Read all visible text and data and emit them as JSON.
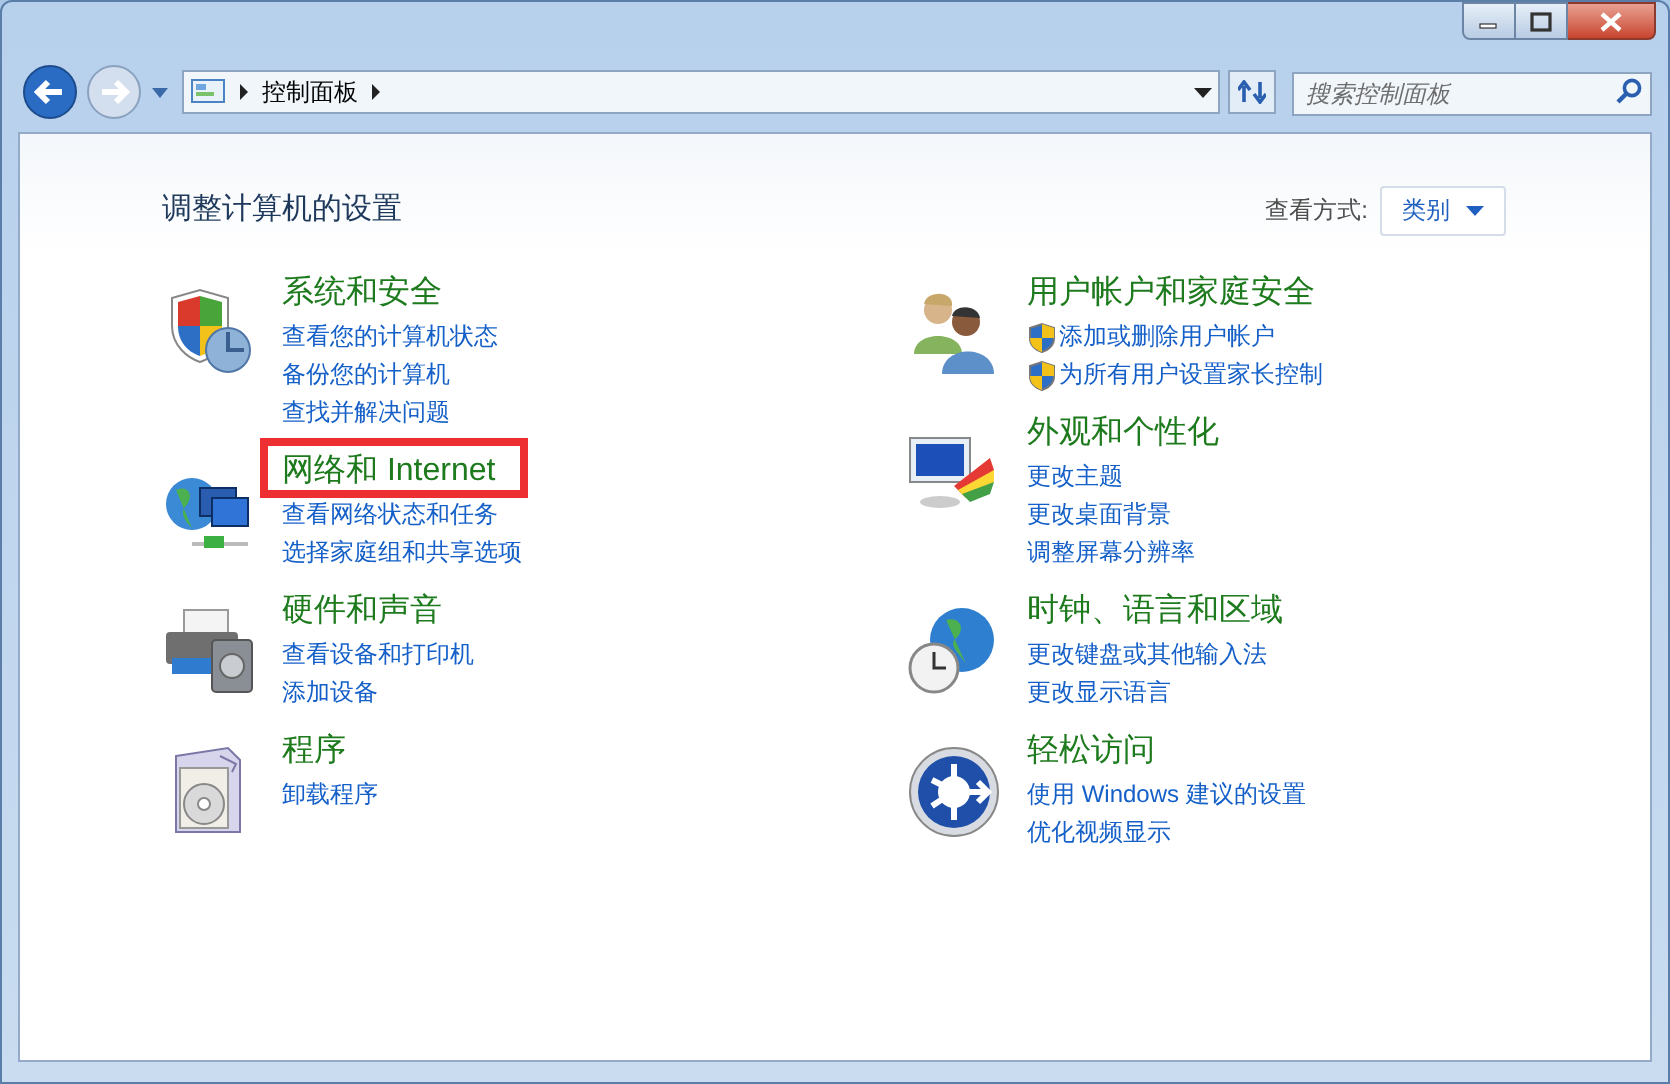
{
  "address_bar": {
    "path": [
      "控制面板"
    ]
  },
  "search": {
    "placeholder": "搜索控制面板"
  },
  "page_title": "调整计算机的设置",
  "view_by": {
    "label": "查看方式:",
    "value": "类别"
  },
  "left_column": [
    {
      "title": "系统和安全",
      "highlighted": false,
      "links": [
        {
          "text": "查看您的计算机状态",
          "shield": false
        },
        {
          "text": "备份您的计算机",
          "shield": false
        },
        {
          "text": "查找并解决问题",
          "shield": false
        }
      ]
    },
    {
      "title": "网络和 Internet",
      "highlighted": true,
      "links": [
        {
          "text": "查看网络状态和任务",
          "shield": false
        },
        {
          "text": "选择家庭组和共享选项",
          "shield": false
        }
      ]
    },
    {
      "title": "硬件和声音",
      "highlighted": false,
      "links": [
        {
          "text": "查看设备和打印机",
          "shield": false
        },
        {
          "text": "添加设备",
          "shield": false
        }
      ]
    },
    {
      "title": "程序",
      "highlighted": false,
      "links": [
        {
          "text": "卸载程序",
          "shield": false
        }
      ]
    }
  ],
  "right_column": [
    {
      "title": "用户帐户和家庭安全",
      "highlighted": false,
      "links": [
        {
          "text": "添加或删除用户帐户",
          "shield": true
        },
        {
          "text": "为所有用户设置家长控制",
          "shield": true
        }
      ]
    },
    {
      "title": "外观和个性化",
      "highlighted": false,
      "links": [
        {
          "text": "更改主题",
          "shield": false
        },
        {
          "text": "更改桌面背景",
          "shield": false
        },
        {
          "text": "调整屏幕分辨率",
          "shield": false
        }
      ]
    },
    {
      "title": "时钟、语言和区域",
      "highlighted": false,
      "links": [
        {
          "text": "更改键盘或其他输入法",
          "shield": false
        },
        {
          "text": "更改显示语言",
          "shield": false
        }
      ]
    },
    {
      "title": "轻松访问",
      "highlighted": false,
      "links": [
        {
          "text": "使用 Windows 建议的设置",
          "shield": false
        },
        {
          "text": "优化视频显示",
          "shield": false
        }
      ]
    }
  ]
}
